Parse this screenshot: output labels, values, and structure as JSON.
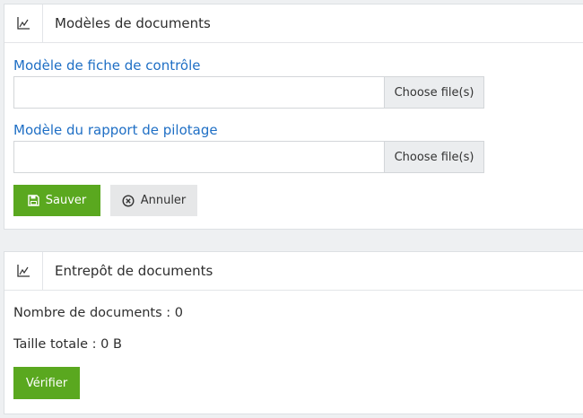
{
  "templates_panel": {
    "title": "Modèles de documents",
    "field1_label": "Modèle de fiche de contrôle",
    "field1_button": "Choose file(s)",
    "field2_label": "Modèle du rapport de pilotage",
    "field2_button": "Choose file(s)",
    "save_label": "Sauver",
    "cancel_label": "Annuler",
    "icons": {
      "header": "chart-line-icon",
      "save": "floppy-disk-icon",
      "cancel": "circle-x-icon"
    }
  },
  "storage_panel": {
    "title": "Entrepôt de documents",
    "doc_count": "Nombre de documents : 0",
    "total_size": "Taille totale : 0 B",
    "verify_label": "Vérifier",
    "icons": {
      "header": "chart-line-icon"
    }
  },
  "colors": {
    "accent_green": "#5aa81f",
    "label_blue": "#1f6fc5"
  }
}
